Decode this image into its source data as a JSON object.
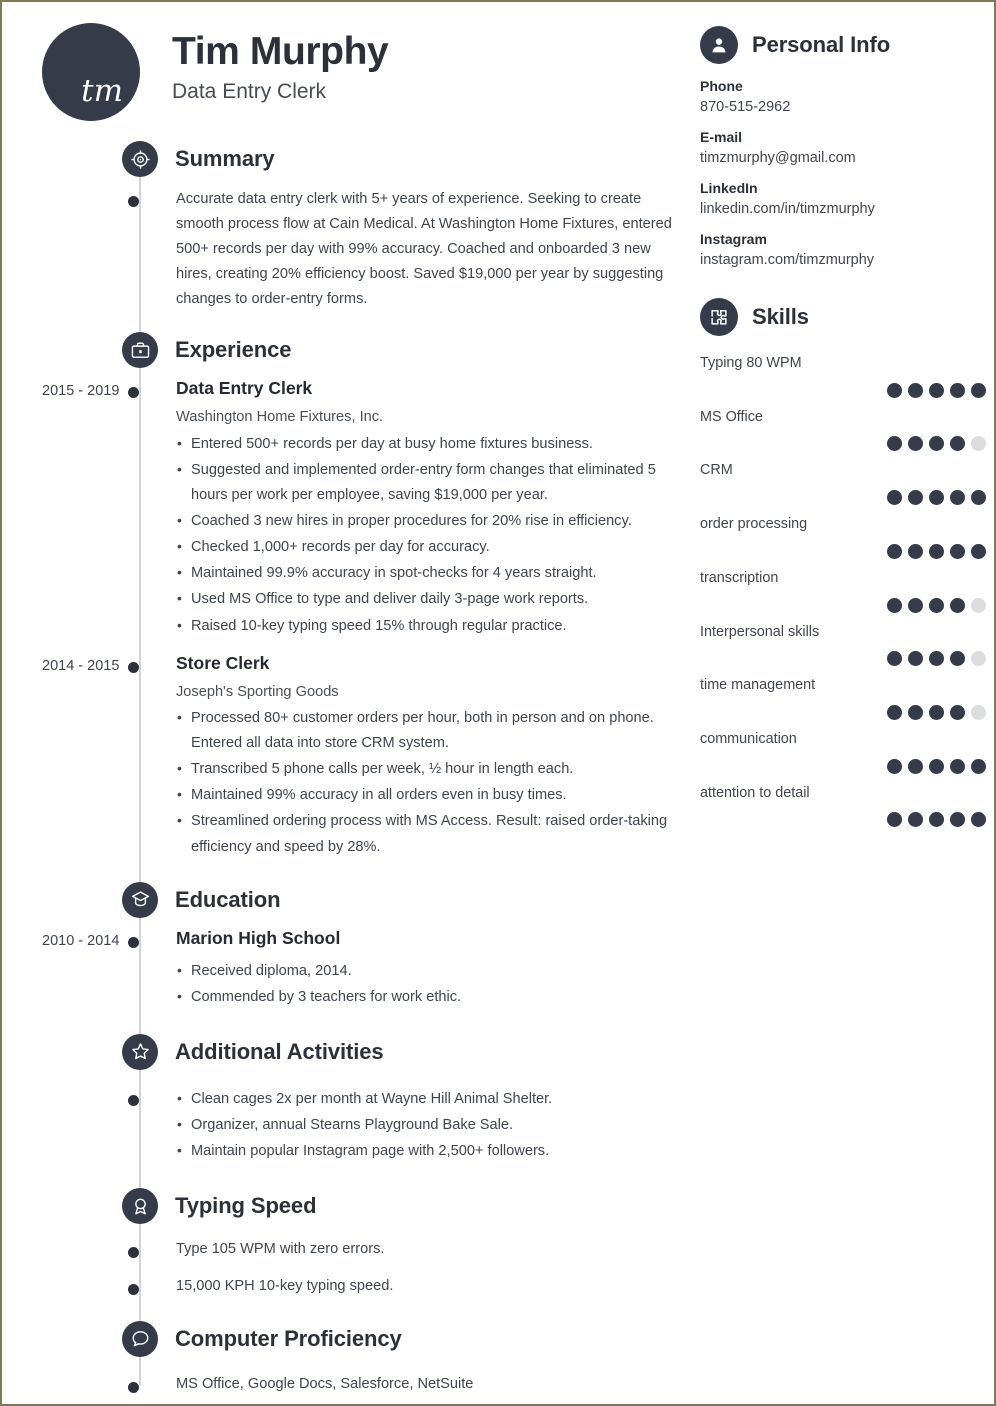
{
  "theme": {
    "accent": "#353b49",
    "text": "#3f444e",
    "dot_off": "#dcdddf",
    "page_border": "#7d7a55"
  },
  "header": {
    "monogram": "tm",
    "name": "Tim Murphy",
    "job_title": "Data Entry Clerk"
  },
  "sections": {
    "summary": {
      "title": "Summary",
      "icon": "target-icon",
      "text": "Accurate data entry clerk with 5+ years of experience. Seeking to create smooth process flow at Cain Medical. At Washington Home Fixtures, entered 500+ records per day with 99% accuracy. Coached and onboarded 3 new hires, creating 20% efficiency boost. Saved $19,000 per year by suggesting changes to order-entry forms."
    },
    "experience": {
      "title": "Experience",
      "icon": "briefcase-icon",
      "jobs": [
        {
          "dates": "2015 - 2019",
          "title": "Data Entry Clerk",
          "company": "Washington Home Fixtures, Inc.",
          "bullets": [
            "Entered 500+ records per day at busy home fixtures business.",
            "Suggested and implemented order-entry form changes that eliminated 5 hours per work per employee, saving $19,000 per year.",
            "Coached 3 new hires in proper procedures for 20% rise in efficiency.",
            "Checked 1,000+ records per day for accuracy.",
            "Maintained 99.9% accuracy in spot-checks for 4 years straight.",
            "Used MS Office to type and deliver daily 3-page work reports.",
            "Raised 10-key typing speed 15% through regular practice."
          ]
        },
        {
          "dates": "2014 - 2015",
          "title": "Store Clerk",
          "company": "Joseph's Sporting Goods",
          "bullets": [
            "Processed 80+ customer orders per hour, both in person and on phone. Entered all data into store CRM system.",
            "Transcribed 5 phone calls per week, ½ hour in length each.",
            "Maintained 99% accuracy in all orders even in busy times.",
            "Streamlined ordering process with MS Access. Result: raised order-taking efficiency and speed by 28%."
          ]
        }
      ]
    },
    "education": {
      "title": "Education",
      "icon": "graduation-cap-icon",
      "entries": [
        {
          "dates": "2010 - 2014",
          "title": "Marion High School",
          "bullets": [
            "Received diploma, 2014.",
            "Commended by 3 teachers for work ethic."
          ]
        }
      ]
    },
    "activities": {
      "title": "Additional Activities",
      "icon": "star-icon",
      "bullets": [
        "Clean cages 2x per month at Wayne Hill Animal Shelter.",
        "Organizer, annual Stearns Playground Bake Sale.",
        "Maintain popular Instagram page with 2,500+ followers."
      ]
    },
    "typing_speed": {
      "title": "Typing Speed",
      "icon": "award-ribbon-icon",
      "lines": [
        "Type 105 WPM with zero errors.",
        "15,000 KPH 10-key typing speed."
      ]
    },
    "computer_proficiency": {
      "title": "Computer Proficiency",
      "icon": "speech-bubble-icon",
      "lines": [
        "MS Office, Google Docs, Salesforce, NetSuite"
      ]
    }
  },
  "personal_info": {
    "title": "Personal Info",
    "icon": "person-icon",
    "fields": [
      {
        "label": "Phone",
        "value": "870-515-2962"
      },
      {
        "label": "E-mail",
        "value": "timzmurphy@gmail.com"
      },
      {
        "label": "LinkedIn",
        "value": "linkedin.com/in/timzmurphy"
      },
      {
        "label": "Instagram",
        "value": "instagram.com/timzmurphy"
      }
    ]
  },
  "skills": {
    "title": "Skills",
    "icon": "puzzle-piece-icon",
    "max_rating": 5,
    "items": [
      {
        "name": "Typing 80 WPM",
        "rating": 5
      },
      {
        "name": "MS Office",
        "rating": 4
      },
      {
        "name": "CRM",
        "rating": 5
      },
      {
        "name": "order processing",
        "rating": 5
      },
      {
        "name": "transcription",
        "rating": 4
      },
      {
        "name": "Interpersonal skills",
        "rating": 4
      },
      {
        "name": "time management",
        "rating": 4
      },
      {
        "name": "communication",
        "rating": 5
      },
      {
        "name": "attention to detail",
        "rating": 5
      }
    ]
  }
}
